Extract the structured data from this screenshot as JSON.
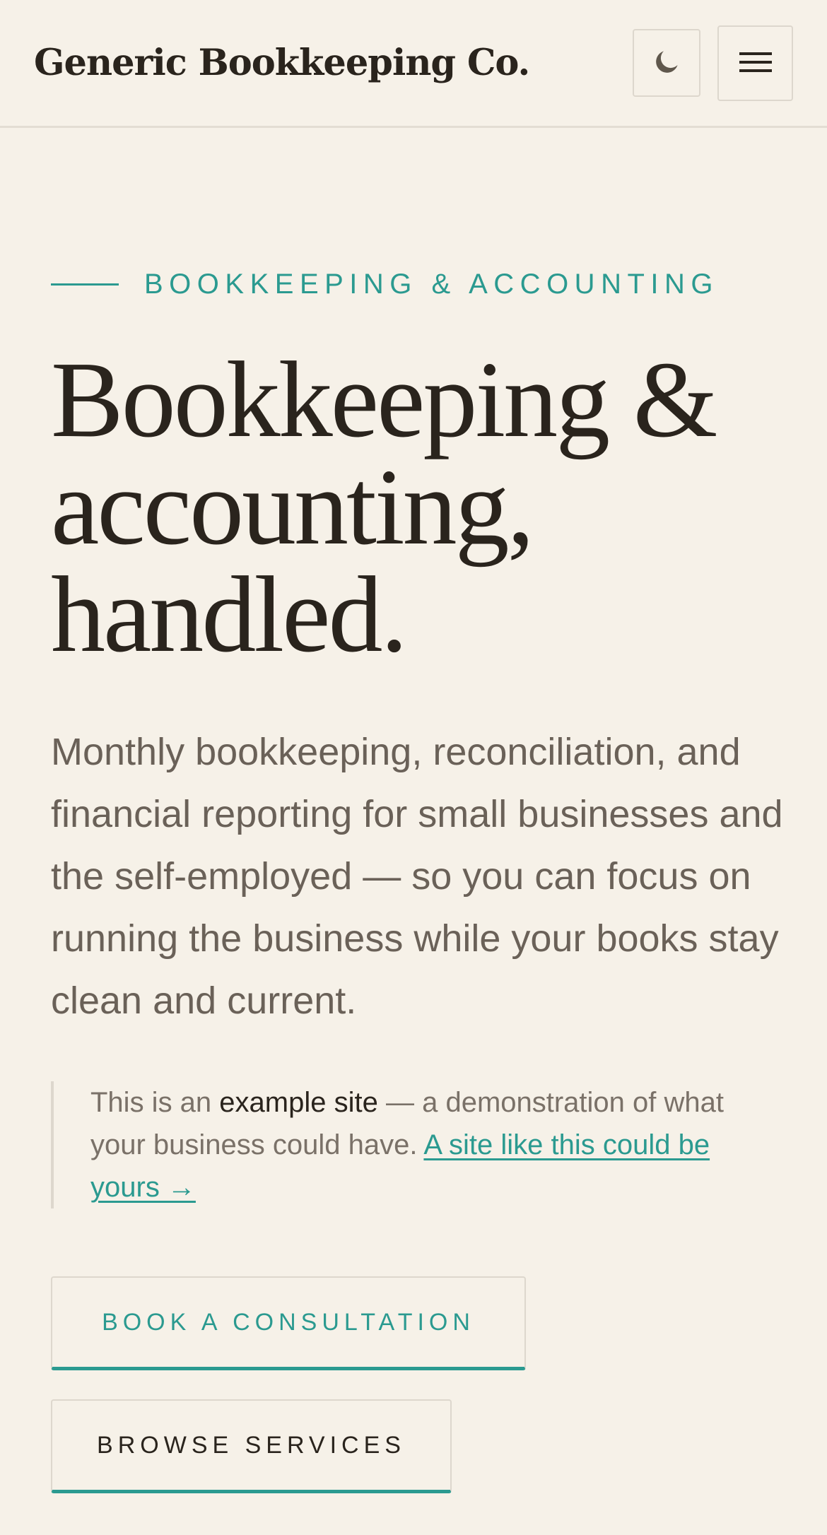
{
  "header": {
    "brand": "Generic Bookkeeping Co.",
    "icons": {
      "theme_toggle": "moon-icon",
      "menu": "hamburger-icon"
    }
  },
  "hero": {
    "eyebrow": "BOOKKEEPING & ACCOUNTING",
    "title_lines": [
      "Bookkeeping &",
      "accounting,",
      "handled."
    ],
    "lede": "Monthly bookkeeping, reconciliation, and financial reporting for small businesses and the self-employed — so you can focus on running the business while your books stay clean and current.",
    "notice": {
      "prefix": "This is an ",
      "strong": "example site",
      "middle": " — a demonstration of what your business could have. ",
      "link": "A site like this could be yours →"
    },
    "buttons": {
      "primary": "BOOK A CONSULTATION",
      "secondary": "BROWSE SERVICES"
    }
  },
  "colors": {
    "background": "#f6f1e8",
    "accent": "#2b9a90",
    "text": "#2a241d",
    "muted": "#6a6158"
  }
}
